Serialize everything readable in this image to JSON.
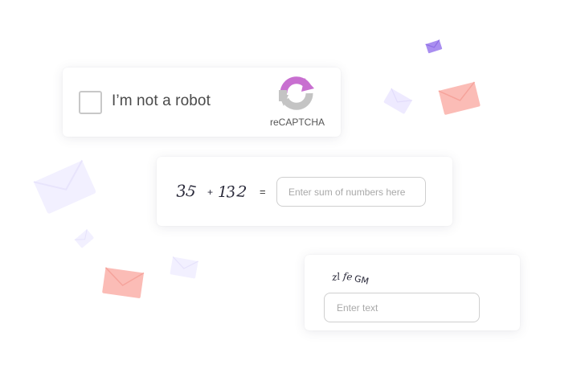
{
  "recaptcha": {
    "checkbox_label": "I’m not a robot",
    "brand": "reCAPTCHA",
    "logo_icon": "recaptcha-logo-icon",
    "logo_colors": {
      "top": "#c86fd0",
      "bottom": "#c4c4c4"
    }
  },
  "math_captcha": {
    "expression": "35 + 132",
    "operator": "+",
    "equals": "=",
    "placeholder": "Enter sum of numbers here"
  },
  "text_captcha": {
    "challenge": "zlfeGM",
    "placeholder": "Enter text"
  },
  "decor": {
    "envelope_colors": [
      "#fbbcb6",
      "#a88cf0",
      "#eeeaff"
    ],
    "icon": "envelope-icon"
  }
}
